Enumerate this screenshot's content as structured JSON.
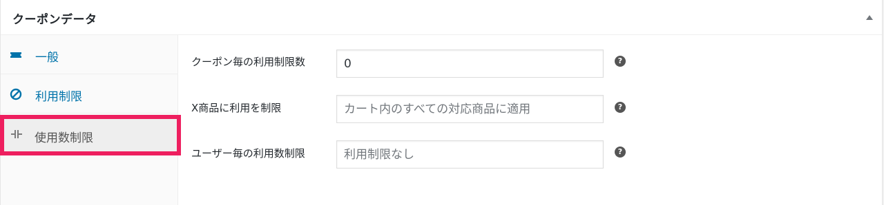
{
  "panel": {
    "title": "クーポンデータ"
  },
  "tabs": [
    {
      "label": "一般",
      "icon": "ticket-icon"
    },
    {
      "label": "利用制限",
      "icon": "restricted-circle-icon"
    },
    {
      "label": "使用数制限",
      "icon": "limit-arrows-icon",
      "active": true
    }
  ],
  "fields": [
    {
      "label": "クーポン毎の利用制限数",
      "value": "0",
      "placeholder": ""
    },
    {
      "label": "X商品に利用を制限",
      "value": "",
      "placeholder": "カート内のすべての対応商品に適用"
    },
    {
      "label": "ユーザー毎の利用数制限",
      "value": "",
      "placeholder": "利用制限なし"
    }
  ],
  "help_glyph": "?",
  "colors": {
    "link": "#0073aa",
    "highlight_border": "#ee1f5f",
    "active_tab_bg": "#eeeeee"
  }
}
